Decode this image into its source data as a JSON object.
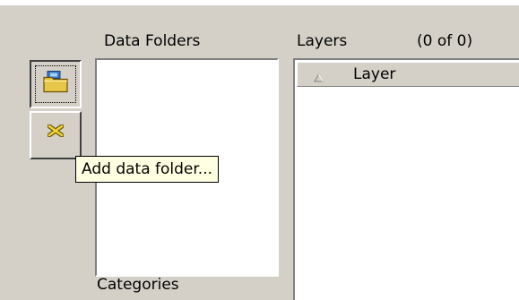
{
  "folders": {
    "label": "Data Folders"
  },
  "layers": {
    "label": "Layers",
    "count": "(0 of 0)",
    "column_header": "Layer",
    "sort_icon": "sort-ascending-triangle"
  },
  "toolbar": {
    "add_button_icon": "folder-add-icon",
    "remove_button_icon": "remove-x-icon",
    "tooltip": "Add data folder..."
  },
  "categories": {
    "label": "Categories"
  }
}
